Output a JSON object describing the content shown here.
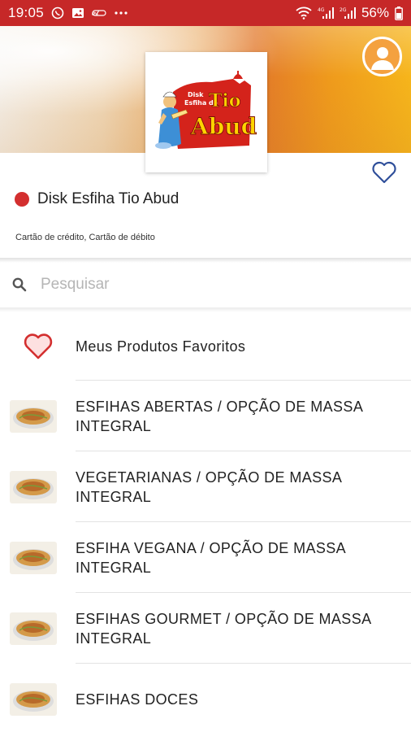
{
  "status_bar": {
    "time": "19:05",
    "battery": "56%",
    "left_icons": [
      "whatsapp-icon",
      "gallery-icon",
      "app-icon",
      "more-dots-icon"
    ],
    "right_icons": [
      "wifi-icon",
      "signal-4g-icon",
      "signal-2g-icon",
      "battery-icon"
    ],
    "signal_labels": [
      "4G",
      "2G"
    ],
    "color": "#c62828"
  },
  "store": {
    "logo_text": {
      "top": "Disk",
      "middle": "Esfiha do",
      "main1": "Tio",
      "main2": "Abud"
    },
    "name": "Disk Esfiha Tio Abud",
    "status_color": "#d32f2f",
    "payments": "Cartão de crédito, Cartão de débito"
  },
  "search": {
    "placeholder": "Pesquisar",
    "value": ""
  },
  "favorites": {
    "label": "Meus Produtos Favoritos"
  },
  "categories": [
    {
      "label_line1": "ESFIHAS ABERTAS / OPÇÃO DE MASSA",
      "label_line2": "INTEGRAL"
    },
    {
      "label_line1": "VEGETARIANAS / OPÇÃO DE MASSA",
      "label_line2": "INTEGRAL"
    },
    {
      "label_line1": "ESFIHA VEGANA / OPÇÃO DE MASSA",
      "label_line2": "INTEGRAL"
    },
    {
      "label_line1": "ESFIHAS GOURMET / OPÇÃO DE MASSA",
      "label_line2": "INTEGRAL"
    },
    {
      "label_line1": "ESFIHAS DOCES",
      "label_line2": ""
    }
  ],
  "colors": {
    "accent_red": "#d32f2f",
    "heart_outline_blue": "#2f4f9a",
    "avatar_orange": "#f4a13f"
  }
}
